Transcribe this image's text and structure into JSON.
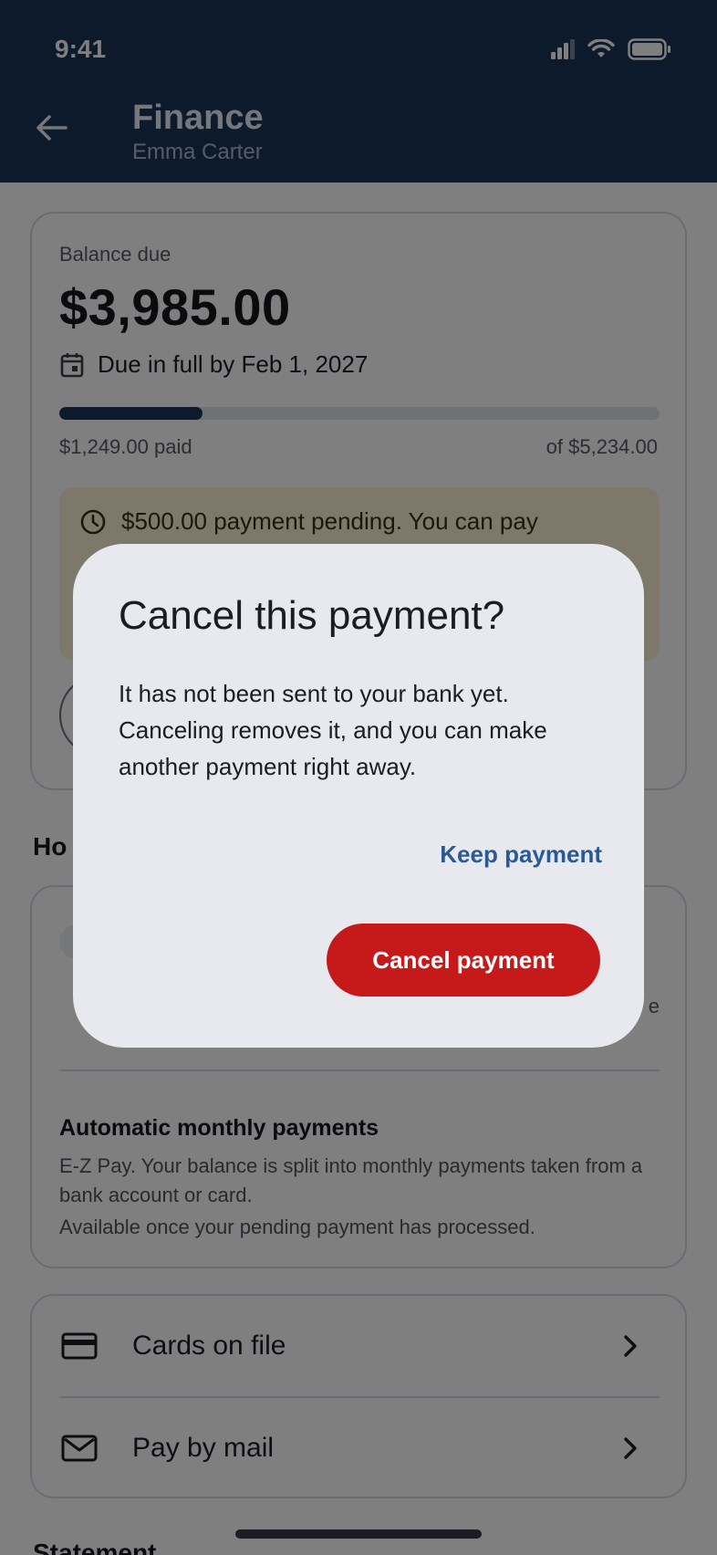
{
  "status_bar": {
    "time": "9:41"
  },
  "app_bar": {
    "title": "Finance",
    "subtitle": "Emma Carter"
  },
  "balance": {
    "label": "Balance due",
    "amount": "$3,985.00",
    "due_text": "Due in full by Feb 1, 2027",
    "paid_text": "$1,249.00 paid",
    "total_text": "of $5,234.00",
    "progress_fraction": 0.239
  },
  "pending_banner": {
    "text": "$500.00 payment pending. You can pay"
  },
  "payment_options": {
    "heading": "Ho",
    "partial_trailing_text": "e",
    "auto_title": "Automatic monthly payments",
    "auto_desc": "E-Z Pay. Your balance is split into monthly payments taken from a bank account or card.",
    "auto_note": "Available once your pending payment has processed."
  },
  "links": [
    {
      "label": "Cards on file",
      "icon": "credit-card-icon"
    },
    {
      "label": "Pay by mail",
      "icon": "mail-icon"
    }
  ],
  "statement_heading": "Statement",
  "dialog": {
    "title": "Cancel this payment?",
    "body": "It has not been sent to your bank yet. Canceling removes it, and you can make another payment right away.",
    "keep_label": "Keep payment",
    "cancel_label": "Cancel payment"
  },
  "colors": {
    "app_bar": "#1b3556",
    "danger": "#c61a1a",
    "link": "#2a5a96",
    "pending_bg": "#fdf0d4"
  }
}
